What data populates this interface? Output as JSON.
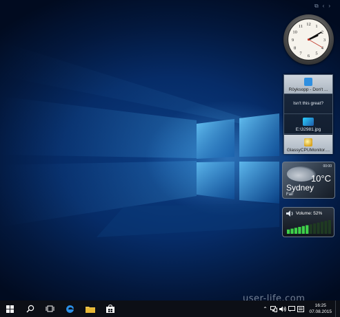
{
  "gadget_toolbar": {
    "icons": [
      "gadgets-icon",
      "previous-icon",
      "next-icon"
    ]
  },
  "clock_gadget": {
    "hour": 2,
    "minute": 10,
    "second": 20
  },
  "feed_panel": {
    "items": [
      {
        "label": "Röyksopp - Don't ...",
        "icon": "app-icon"
      },
      {
        "label": "Isn't this great?",
        "icon": ""
      },
      {
        "label": "E:\\32981.jpg",
        "icon": "image-icon"
      },
      {
        "label": "GlassyCPUMonitor....",
        "icon": "gadget-icon"
      }
    ]
  },
  "weather": {
    "time": "00:00",
    "temperature": "10°C",
    "city": "Sydney",
    "condition": "Fair"
  },
  "volume": {
    "label": "Volume: 52%",
    "level": 0.52
  },
  "watermark": {
    "text": "user-life.com"
  },
  "taskbar": {
    "buttons": [
      "start-icon",
      "search-icon",
      "task-view-icon",
      "edge-icon",
      "file-explorer-icon",
      "store-icon"
    ],
    "tray_icons": [
      "network-icon",
      "speaker-icon",
      "message-icon",
      "language-icon"
    ],
    "time": "16:25",
    "date": "07.08.2015"
  },
  "colors": {
    "accent": "#1f8ef1",
    "desktop_bg": "#062c68",
    "taskbar_bg": "#0c0f16",
    "volume_on": "#3fd14a",
    "volume_off": "#1f3a22"
  }
}
